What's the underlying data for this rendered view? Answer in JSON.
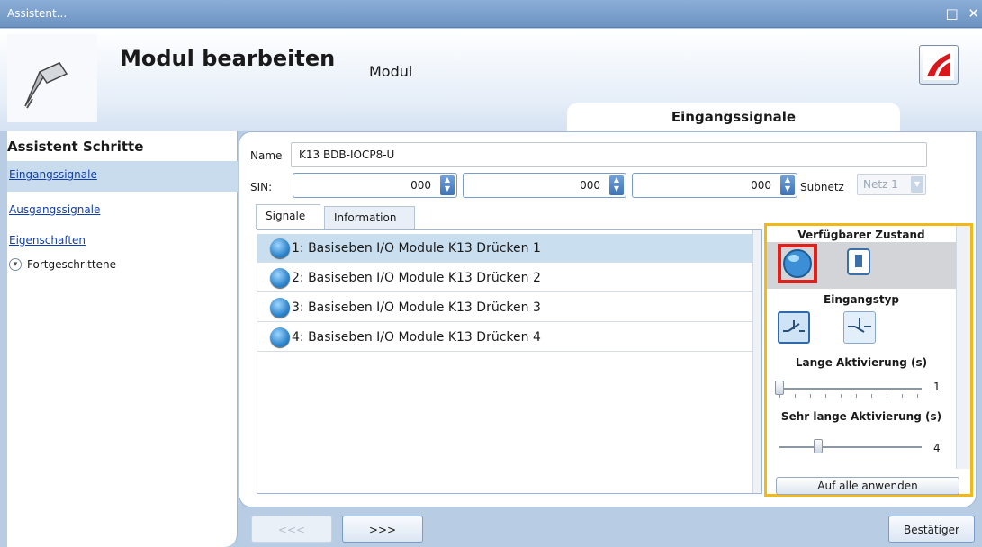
{
  "window": {
    "title": "Assistent...",
    "controls": "□ ✕"
  },
  "header": {
    "title": "Modul bearbeiten",
    "subtitle": "Modul",
    "section_tab": "Eingangssignale"
  },
  "sidebar": {
    "heading": "Assistent Schritte",
    "steps": [
      {
        "label": "Eingangssignale",
        "active": true
      },
      {
        "label": "Ausgangssignale",
        "active": false
      },
      {
        "label": "Eigenschaften",
        "active": false
      }
    ],
    "advanced_label": "Fortgeschrittene"
  },
  "form": {
    "name_label": "Name",
    "name_value": "K13 BDB-IOCP8-U",
    "sin_label": "SIN:",
    "sin_values": [
      "000",
      "000",
      "000"
    ],
    "subnet_label": "Subnetz",
    "subnet_value": "Netz 1"
  },
  "tabs": [
    {
      "label": "Signale",
      "active": true
    },
    {
      "label": "Information",
      "active": false
    }
  ],
  "signals": [
    {
      "label": "1: Basiseben I/O Module K13 Drücken 1",
      "selected": true
    },
    {
      "label": "2: Basiseben I/O Module K13 Drücken 2",
      "selected": false
    },
    {
      "label": "3: Basiseben I/O Module K13 Drücken 3",
      "selected": false
    },
    {
      "label": "4: Basiseben I/O Module K13 Drücken 4",
      "selected": false
    }
  ],
  "props": {
    "available_state_label": "Verfügbarer Zustand",
    "input_type_label": "Eingangstyp",
    "long_activation_label": "Lange Aktivierung (s)",
    "long_activation_value": "1",
    "long_activation_fraction": 0.0,
    "very_long_activation_label": "Sehr lange Aktivierung (s)",
    "very_long_activation_value": "4",
    "very_long_activation_fraction": 0.27,
    "apply_all_label": "Auf alle anwenden"
  },
  "footer": {
    "back_label": "<<<",
    "next_label": ">>>",
    "confirm_label": "Bestätiger"
  },
  "colors": {
    "highlight_border": "#f2b81a",
    "selected_state": "#e0201a",
    "accent": "#3d72b7"
  }
}
